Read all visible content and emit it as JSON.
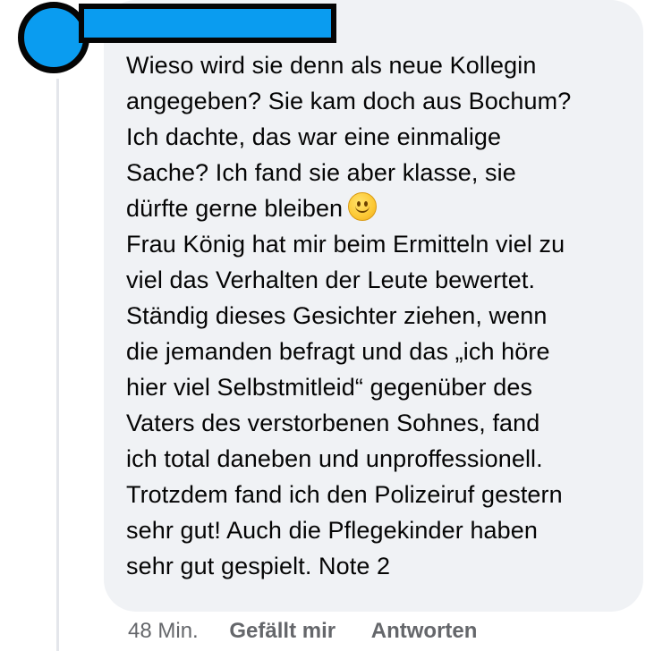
{
  "comment": {
    "lines_first": [
      "Wieso wird sie denn als neue Kollegin",
      "angegeben? Sie kam doch aus Bochum?",
      "Ich dachte, das war eine einmalige",
      "Sache? Ich fand sie aber klasse, sie"
    ],
    "emoji_line_text": "dürfte gerne bleiben",
    "emoji_icon": "slightly-smiling-face-icon",
    "lines_second": [
      "Frau König hat mir beim Ermitteln viel zu",
      "viel das Verhalten der Leute bewertet.",
      "Ständig dieses Gesichter ziehen, wenn",
      "die jemanden befragt und das „ich höre",
      "hier viel Selbstmitleid“ gegenüber des",
      "Vaters des verstorbenen Sohnes, fand",
      "ich total daneben und unproffessionell.",
      "Trotzdem fand ich den Polizeiruf gestern",
      "sehr gut! Auch die Pflegekinder haben",
      "sehr gut gespielt. Note 2"
    ]
  },
  "actions": {
    "time": "48 Min.",
    "like_label": "Gefällt mir",
    "reply_label": "Antworten"
  },
  "colors": {
    "bubble": "#f0f2f5",
    "redaction_fill": "#0a9cf0",
    "redaction_border": "#050505",
    "meta_text": "#65676b"
  }
}
